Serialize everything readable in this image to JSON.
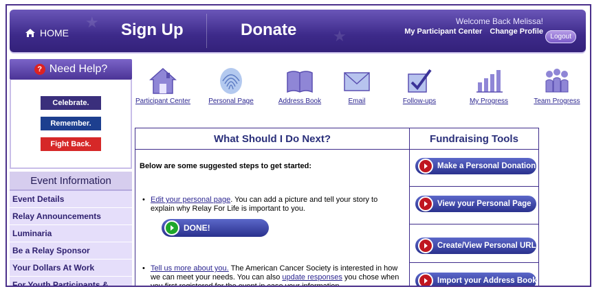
{
  "header": {
    "home_label": "HOME",
    "signup_label": "Sign Up",
    "donate_label": "Donate",
    "welcome": "Welcome Back Melissa!",
    "participant_center": "My Participant Center",
    "change_profile": "Change Profile",
    "logout": "Logout"
  },
  "sidebar": {
    "help_label": "Need Help?",
    "help_icon_glyph": "?",
    "cause_badges": [
      "Celebrate.",
      "Remember.",
      "Fight Back."
    ],
    "event_heading": "Event Information",
    "event_items": [
      "Event Details",
      "Relay Announcements",
      "Luminaria",
      "Be a Relay Sponsor",
      "Your Dollars At Work",
      "For Youth Participants &"
    ]
  },
  "icon_nav": [
    {
      "label": "Participant Center",
      "icon": "house-icon"
    },
    {
      "label": "Personal Page",
      "icon": "fingerprint-icon"
    },
    {
      "label": "Address Book",
      "icon": "book-icon"
    },
    {
      "label": "Email",
      "icon": "envelope-icon"
    },
    {
      "label": "Follow-ups",
      "icon": "checkbox-icon"
    },
    {
      "label": "My Progress",
      "icon": "bar-chart-icon"
    },
    {
      "label": "Team Progress",
      "icon": "team-icon"
    }
  ],
  "next_steps": {
    "heading": "What Should I Do Next?",
    "intro": "Below are some suggested steps to get started:",
    "step1_link": "Edit your personal page",
    "step1_text": ". You can add a picture and tell your story to explain why Relay For Life is important to you.",
    "done_label": "DONE!",
    "step2_link": "Tell us more about you.",
    "step2_text_a": " The American Cancer Society is interested in how we can meet your needs. You can also ",
    "step2_link2": "update responses",
    "step2_text_b": " you chose when you first registered for the event in case your information"
  },
  "tools": {
    "heading": "Fundraising Tools",
    "buttons": [
      "Make a Personal Donation",
      "View your Personal Page",
      "Create/View Personal URL",
      "Import your Address Book"
    ]
  },
  "colors": {
    "brand_purple": "#3d2a8a",
    "button_blue": "#2a318d",
    "action_red": "#c01620",
    "done_green": "#1da62a"
  }
}
